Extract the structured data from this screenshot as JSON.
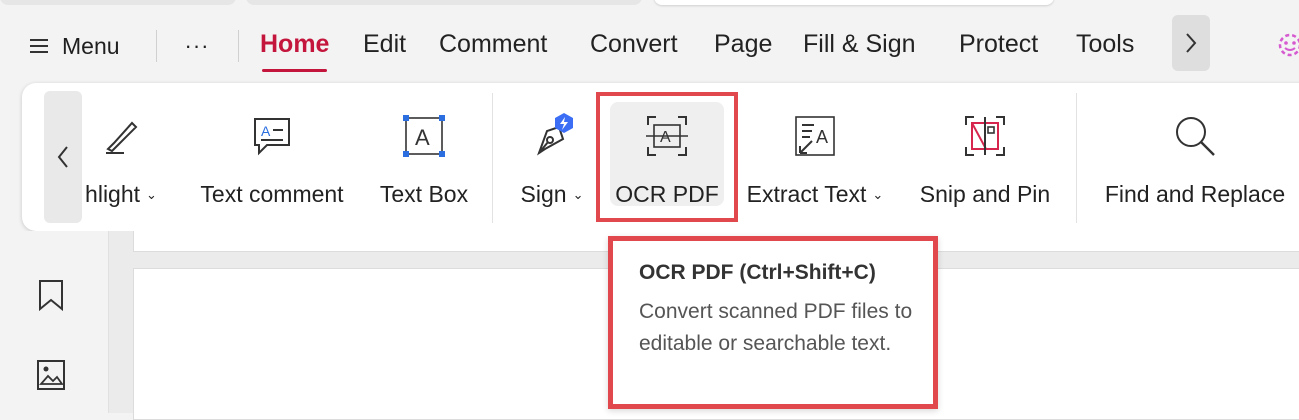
{
  "menubar": {
    "menu_label": "Menu",
    "more_label": "···",
    "tabs": [
      "Home",
      "Edit",
      "Comment",
      "Convert",
      "Page",
      "Fill & Sign",
      "Protect",
      "Tools"
    ],
    "active_tab": "Home"
  },
  "ribbon": {
    "tools": [
      {
        "label": "hlight",
        "has_dropdown": true,
        "icon": "highlighter-icon"
      },
      {
        "label": "Text comment",
        "has_dropdown": false,
        "icon": "text-comment-icon"
      },
      {
        "label": "Text Box",
        "has_dropdown": false,
        "icon": "text-box-icon"
      },
      {
        "label": "Sign",
        "has_dropdown": true,
        "icon": "sign-pen-icon"
      },
      {
        "label": "OCR PDF",
        "has_dropdown": false,
        "icon": "ocr-scan-icon"
      },
      {
        "label": "Extract Text",
        "has_dropdown": true,
        "icon": "extract-text-icon"
      },
      {
        "label": "Snip and Pin",
        "has_dropdown": false,
        "icon": "snip-pin-icon"
      },
      {
        "label": "Find and Replace",
        "has_dropdown": false,
        "icon": "magnifier-icon"
      }
    ]
  },
  "tooltip": {
    "title": "OCR PDF (Ctrl+Shift+C)",
    "body": "Convert scanned PDF files to editable or searchable text."
  },
  "colors": {
    "accent": "#c4163d",
    "highlight_frame": "#e0484d",
    "sign_badge": "#3b6ef5"
  }
}
